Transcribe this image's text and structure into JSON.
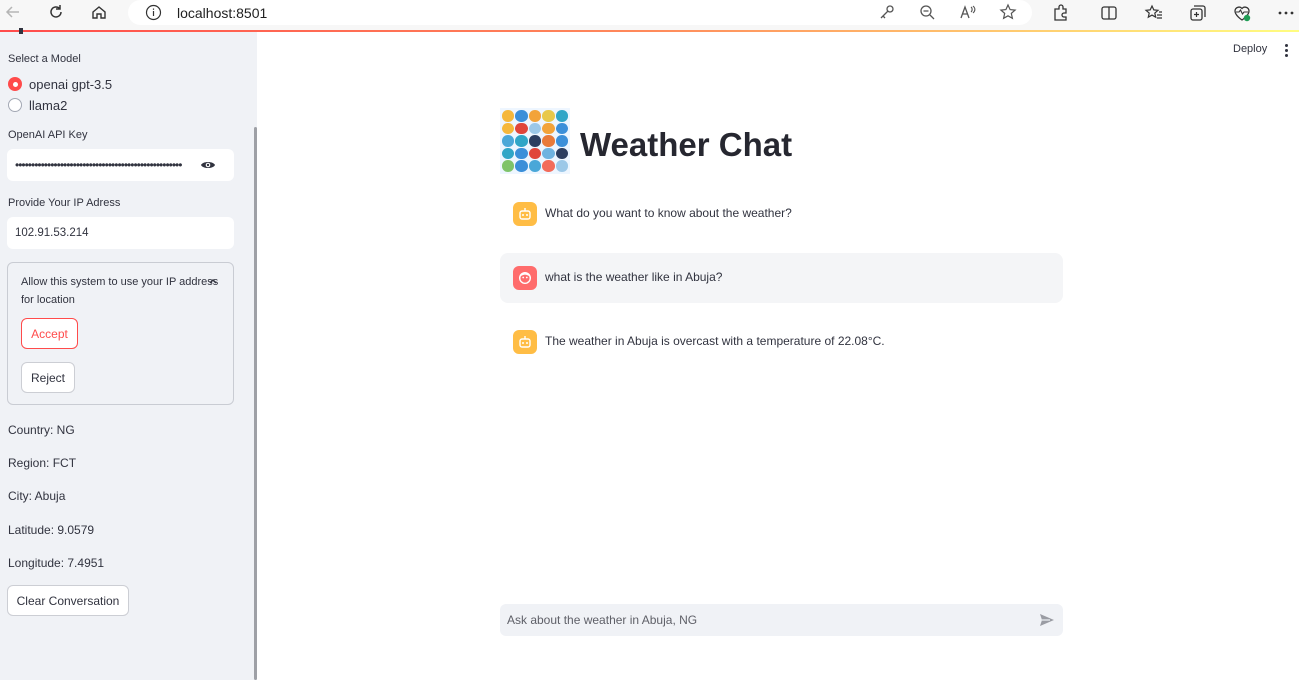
{
  "browser": {
    "url": "localhost:8501"
  },
  "header": {
    "deploy_label": "Deploy"
  },
  "sidebar": {
    "model_label": "Select a Model",
    "models": [
      {
        "label": "openai gpt-3.5",
        "selected": true
      },
      {
        "label": "llama2",
        "selected": false
      }
    ],
    "api_key_label": "OpenAI API Key",
    "api_key_masked": "••••••••••••••••••••••••••••••••••••••••••••••••••••",
    "ip_label": "Provide Your IP Adress",
    "ip_value": "102.91.53.214",
    "permission": {
      "text": "Allow this system to use your IP address for location",
      "accept_label": "Accept",
      "reject_label": "Reject"
    },
    "location": {
      "country": "Country: NG",
      "region": "Region: FCT",
      "city": "City: Abuja",
      "latitude": "Latitude: 9.0579",
      "longitude": "Longitude: 7.4951"
    },
    "clear_label": "Clear Conversation"
  },
  "main": {
    "title": "Weather Chat",
    "messages": [
      {
        "role": "assistant",
        "text": "What do you want to know about the weather?"
      },
      {
        "role": "user",
        "text": "what is the weather like in Abuja?"
      },
      {
        "role": "assistant",
        "text": "The weather in Abuja is overcast with a temperature of 22.08°C."
      }
    ],
    "chat_placeholder": "Ask about the weather in Abuja, NG"
  },
  "colors": {
    "accent": "#ff4b4b",
    "sidebar_bg": "#f0f2f6",
    "bot_avatar": "#ffbd45",
    "user_avatar": "#ff6c6c"
  }
}
